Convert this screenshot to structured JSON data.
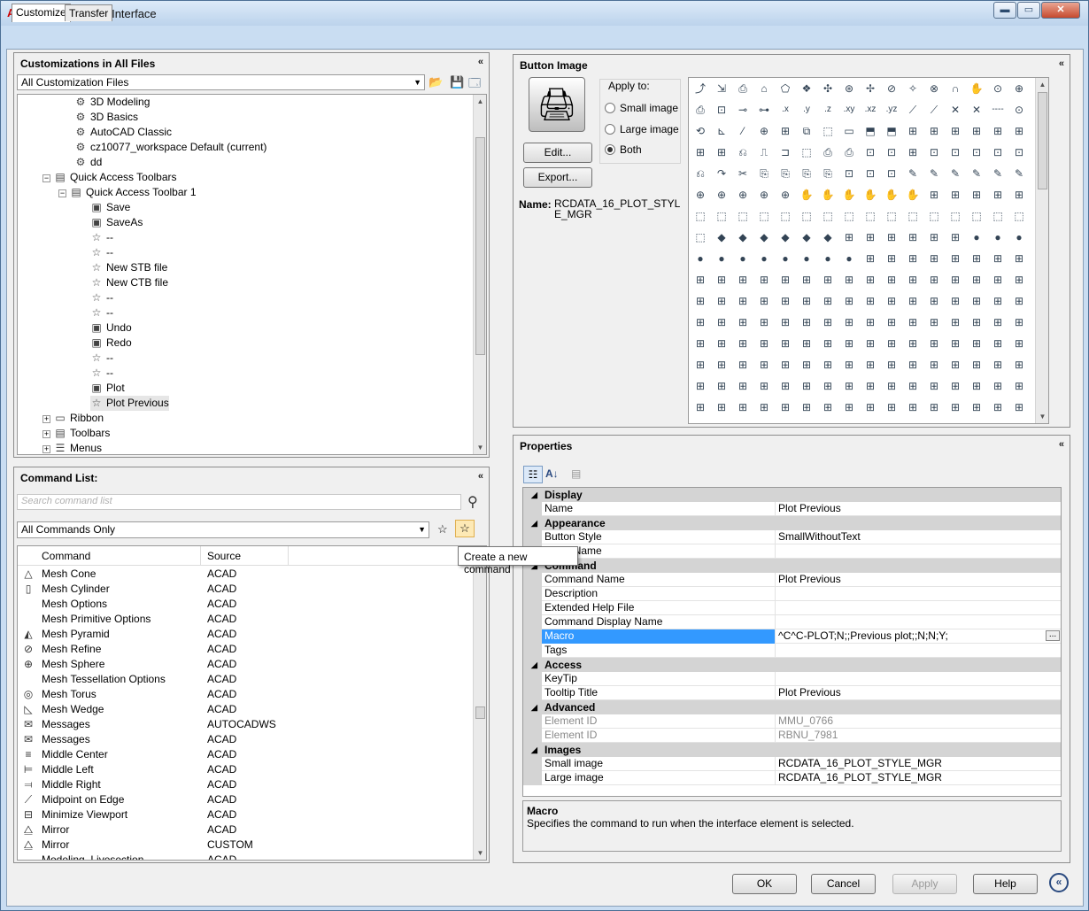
{
  "window": {
    "title": "Customize User Interface",
    "controls": {
      "minimize": "▬",
      "maximize": "▭",
      "close": "✕"
    }
  },
  "tabs": [
    {
      "label": "Customize",
      "active": true
    },
    {
      "label": "Transfer",
      "active": false
    }
  ],
  "customizations": {
    "header": "Customizations in All Files",
    "collapse": "«",
    "dropdown_value": "All Customization Files",
    "tree": [
      {
        "label": "3D Modeling",
        "icon": "gear-icon",
        "indent": 3
      },
      {
        "label": "3D Basics",
        "icon": "gear-icon",
        "indent": 3
      },
      {
        "label": "AutoCAD Classic",
        "icon": "gear-icon",
        "indent": 3
      },
      {
        "label": "cz10077_workspace Default (current)",
        "icon": "gear-icon",
        "indent": 3
      },
      {
        "label": "dd",
        "icon": "gear-icon",
        "indent": 3
      },
      {
        "label": "Quick Access Toolbars",
        "icon": "toolbar-icon",
        "indent": 1,
        "expander": "−"
      },
      {
        "label": "Quick Access Toolbar 1",
        "icon": "toolbar-icon",
        "indent": 2,
        "expander": "−"
      },
      {
        "label": "Save",
        "icon": "command-icon",
        "indent": 4
      },
      {
        "label": "SaveAs",
        "icon": "command-icon",
        "indent": 4
      },
      {
        "label": "--",
        "icon": "star-icon",
        "indent": 4
      },
      {
        "label": "--",
        "icon": "star-icon",
        "indent": 4
      },
      {
        "label": "New STB file",
        "icon": "star-icon",
        "indent": 4
      },
      {
        "label": "New CTB file",
        "icon": "star-icon",
        "indent": 4
      },
      {
        "label": "--",
        "icon": "star-icon",
        "indent": 4
      },
      {
        "label": "--",
        "icon": "star-icon",
        "indent": 4
      },
      {
        "label": "Undo",
        "icon": "command-icon",
        "indent": 4
      },
      {
        "label": "Redo",
        "icon": "command-icon",
        "indent": 4
      },
      {
        "label": "--",
        "icon": "star-icon",
        "indent": 4
      },
      {
        "label": "--",
        "icon": "star-icon",
        "indent": 4
      },
      {
        "label": "Plot",
        "icon": "command-icon",
        "indent": 4
      },
      {
        "label": "Plot Previous",
        "icon": "star-icon",
        "indent": 4,
        "selected": true
      },
      {
        "label": "Ribbon",
        "icon": "folder-icon",
        "indent": 1,
        "expander": "+"
      },
      {
        "label": "Toolbars",
        "icon": "toolbar-icon",
        "indent": 1,
        "expander": "+"
      },
      {
        "label": "Menus",
        "icon": "menu-icon",
        "indent": 1,
        "expander": "+"
      }
    ]
  },
  "command_list": {
    "header": "Command List:",
    "search_placeholder": "Search command list",
    "filter_value": "All Commands Only",
    "columns": [
      "Command",
      "Source"
    ],
    "tooltip": "Create a new command",
    "rows": [
      {
        "cmd": "Mesh Cone",
        "src": "ACAD",
        "icon": "△"
      },
      {
        "cmd": "Mesh Cylinder",
        "src": "ACAD",
        "icon": "▯"
      },
      {
        "cmd": "Mesh Options",
        "src": "ACAD",
        "icon": ""
      },
      {
        "cmd": "Mesh Primitive Options",
        "src": "ACAD",
        "icon": ""
      },
      {
        "cmd": "Mesh Pyramid",
        "src": "ACAD",
        "icon": "◭"
      },
      {
        "cmd": "Mesh Refine",
        "src": "ACAD",
        "icon": "⊘"
      },
      {
        "cmd": "Mesh Sphere",
        "src": "ACAD",
        "icon": "⊕"
      },
      {
        "cmd": "Mesh Tessellation Options",
        "src": "ACAD",
        "icon": ""
      },
      {
        "cmd": "Mesh Torus",
        "src": "ACAD",
        "icon": "◎"
      },
      {
        "cmd": "Mesh Wedge",
        "src": "ACAD",
        "icon": "◺"
      },
      {
        "cmd": "Messages",
        "src": "AUTOCADWS",
        "icon": "✉"
      },
      {
        "cmd": "Messages",
        "src": "ACAD",
        "icon": "✉"
      },
      {
        "cmd": "Middle Center",
        "src": "ACAD",
        "icon": "≡"
      },
      {
        "cmd": "Middle Left",
        "src": "ACAD",
        "icon": "⊨"
      },
      {
        "cmd": "Middle Right",
        "src": "ACAD",
        "icon": "⫤"
      },
      {
        "cmd": "Midpoint on Edge",
        "src": "ACAD",
        "icon": "⟋"
      },
      {
        "cmd": "Minimize Viewport",
        "src": "ACAD",
        "icon": "⊟"
      },
      {
        "cmd": "Mirror",
        "src": "ACAD",
        "icon": "⧋"
      },
      {
        "cmd": "Mirror",
        "src": "CUSTOM",
        "icon": "⧋"
      },
      {
        "cmd": "Modeling, Livesection",
        "src": "ACAD",
        "icon": ""
      }
    ]
  },
  "button_image": {
    "header": "Button Image",
    "apply_to_label": "Apply to:",
    "options": [
      "Small image",
      "Large image",
      "Both"
    ],
    "selected_option": "Both",
    "edit_label": "Edit...",
    "export_label": "Export...",
    "name_label": "Name:",
    "name_value": "RCDATA_16_PLOT_STYLE_MGR",
    "grid_glyphs": [
      "⤴",
      "⇲",
      "⎙",
      "⌂",
      "⬠",
      "❖",
      "✣",
      "⊛",
      "✢",
      "⊘",
      "✧",
      "⊗",
      "∩",
      "✋",
      "⊙",
      "⊕",
      "⋏",
      "⎙",
      "⊡",
      "⊸",
      "⊶",
      ".x",
      ".y",
      ".z",
      ".xy",
      ".xz",
      ".yz",
      "⟋",
      "⟋",
      "✕",
      "✕",
      "----",
      "⊙",
      "⊙",
      "⟲",
      "⊾",
      "⁄",
      "⊕",
      "⊞",
      "⧉",
      "⬚",
      "▭",
      "⬒",
      "⬒",
      "⊞",
      "⊞",
      "⊞",
      "⊞",
      "⊞",
      "⊞",
      "⬚",
      "⊞",
      "⊞",
      "⎌",
      "⎍",
      "⊐",
      "⬚",
      "⎙",
      "⎙",
      "⊡",
      "⊡",
      "⊞",
      "⊡",
      "⊡",
      "⊡",
      "⊡",
      "⊡",
      "⊡",
      "⎌",
      "↷",
      "✂",
      "⎘",
      "⎘",
      "⎘",
      "⎘",
      "⊡",
      "⊡",
      "⊡",
      "✎",
      "✎",
      "✎",
      "✎",
      "✎",
      "✎",
      "⊕",
      "⊕",
      "⊕",
      "⊕",
      "⊕",
      "⊕",
      "✋",
      "✋",
      "✋",
      "✋",
      "✋",
      "✋",
      "⊞",
      "⊞",
      "⊞",
      "⊞",
      "⊞",
      "⊞",
      "⬚",
      "⬚",
      "⬚",
      "⬚",
      "⬚",
      "⬚",
      "⬚",
      "⬚",
      "⬚",
      "⬚",
      "⬚",
      "⬚",
      "⬚",
      "⬚",
      "⬚",
      "⬚",
      "⬚",
      "⬚",
      "◆",
      "◆",
      "◆",
      "◆",
      "◆",
      "◆",
      "⊞",
      "⊞",
      "⊞",
      "⊞",
      "⊞",
      "⊞",
      "●",
      "●",
      "●",
      "●",
      "●",
      "●",
      "●",
      "●",
      "●",
      "●",
      "●",
      "●",
      "⊞",
      "⊞",
      "⊞",
      "⊞",
      "⊞",
      "⊞",
      "⊞",
      "⊞",
      "⊞",
      "⊞",
      "⊞",
      "⊞",
      "⊞",
      "⊞",
      "⊞",
      "⊞",
      "⊞",
      "⊞",
      "⊞",
      "⊞",
      "⊞",
      "⊞",
      "⊞",
      "⊞",
      "⊞",
      "⊞",
      "⊞",
      "⊞",
      "⊞",
      "⊞",
      "⊞",
      "⊞",
      "⊞",
      "⊞",
      "⊞",
      "⊞",
      "⊞",
      "⊞",
      "⊞",
      "⊞",
      "⊞",
      "⊞",
      "⊞",
      "⊞",
      "⊞",
      "⊞",
      "⊞",
      "⊞",
      "⊞",
      "⊞",
      "⊞",
      "⊞",
      "⊞",
      "⊞",
      "⊞",
      "⊞",
      "⊞",
      "⊞",
      "⊞",
      "⊞",
      "⊞",
      "⊞",
      "⊞",
      "⊞",
      "⊞",
      "⊞",
      "⊞",
      "⊞",
      "⊞",
      "⊞",
      "⊞",
      "⊞",
      "⊞",
      "⊞",
      "⊞",
      "⊞",
      "⊞",
      "⊞",
      "⊞",
      "⊞",
      "⊞",
      "⊞",
      "⊞",
      "⊞",
      "⊞",
      "⊞",
      "⊞",
      "⊞",
      "⊞",
      "⊞",
      "⊞",
      "⊞",
      "⊞",
      "⊞",
      "⊞",
      "⊞",
      "⊞",
      "⊞",
      "⊞",
      "⊞",
      "⊞",
      "⊞",
      "⊞",
      "⊞",
      "⊞",
      "⊞",
      "⊞",
      "⊞",
      "⊞",
      "⊞",
      "⊞",
      "⊞",
      "⊞",
      "⊞",
      "⊞",
      "⊞",
      "⊞",
      "⊞",
      "⊞",
      "⊞",
      "⊞",
      "⊞",
      "⊞",
      "⊞",
      "⊞",
      "⊞",
      "⊞",
      "⊞",
      "⊞",
      "⊞",
      "⊞",
      "⊞",
      "⊞",
      "⊞",
      "⊞",
      "⊞",
      "⊞",
      "⊞",
      "⊞",
      "⊞",
      "⊞",
      "⊞",
      "⊞",
      "⊞",
      "⊞",
      "⊞",
      "⊞",
      "⊞",
      "⊞",
      "⊞",
      "⊞",
      "⊞",
      "⊞",
      "⊞",
      "⊞",
      "⊞",
      "⊞",
      "⊞",
      "⊞",
      "⊞",
      "⊞",
      "⊞",
      "⊞",
      "⊞",
      "⊞",
      "⊞",
      "⊞",
      "⊞",
      "⊞",
      "⊞",
      "⊞",
      "⊞",
      "⊞",
      "⊞",
      "⊞",
      "⊞",
      "⊞",
      "⊞",
      "⊞",
      "⊞"
    ]
  },
  "properties": {
    "header": "Properties",
    "sections": [
      {
        "name": "Display",
        "rows": [
          {
            "k": "Name",
            "v": "Plot Previous"
          }
        ]
      },
      {
        "name": "Appearance",
        "rows": [
          {
            "k": "Button Style",
            "v": "SmallWithoutText"
          },
          {
            "k": "Label Name",
            "v": ""
          }
        ]
      },
      {
        "name": "Command",
        "rows": [
          {
            "k": "Command Name",
            "v": "Plot Previous"
          },
          {
            "k": "Description",
            "v": ""
          },
          {
            "k": "Extended Help File",
            "v": ""
          },
          {
            "k": "Command Display Name",
            "v": ""
          },
          {
            "k": "Macro",
            "v": "^C^C-PLOT;N;;Previous plot;;N;N;Y;",
            "highlight": true
          },
          {
            "k": "Tags",
            "v": ""
          }
        ]
      },
      {
        "name": "Access",
        "rows": [
          {
            "k": "KeyTip",
            "v": ""
          },
          {
            "k": "Tooltip Title",
            "v": "Plot Previous"
          }
        ]
      },
      {
        "name": "Advanced",
        "rows": [
          {
            "k": "Element ID",
            "v": "MMU_0766",
            "gray": true
          },
          {
            "k": "Element ID",
            "v": "RBNU_7981",
            "gray": true
          }
        ]
      },
      {
        "name": "Images",
        "rows": [
          {
            "k": "Small image",
            "v": "RCDATA_16_PLOT_STYLE_MGR"
          },
          {
            "k": "Large image",
            "v": "RCDATA_16_PLOT_STYLE_MGR"
          }
        ]
      }
    ],
    "desc_title": "Macro",
    "desc_text": "Specifies the command to run when the interface element is selected.",
    "ellipsis": "..."
  },
  "footer": {
    "ok": "OK",
    "cancel": "Cancel",
    "apply": "Apply",
    "help": "Help",
    "expand": "«"
  }
}
